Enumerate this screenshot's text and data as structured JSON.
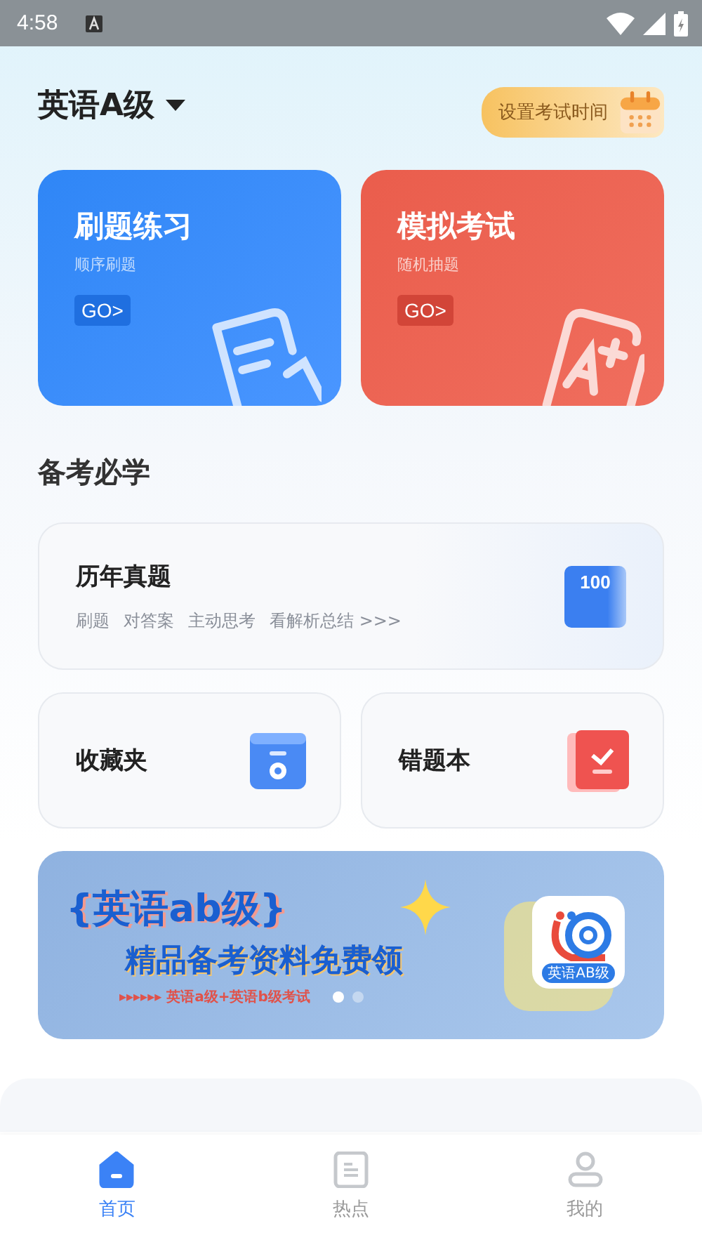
{
  "status_bar": {
    "time": "4:58"
  },
  "header": {
    "title": "英语A级",
    "exam_time_button": "设置考试时间"
  },
  "practice_cards": [
    {
      "kind": "practice",
      "title": "刷题练习",
      "subtitle": "顺序刷题",
      "go": "GO>"
    },
    {
      "kind": "exam",
      "title": "模拟考试",
      "subtitle": "随机抽题",
      "go": "GO>"
    }
  ],
  "section_title": "备考必学",
  "past_papers": {
    "title": "历年真题",
    "tags": [
      "刷题",
      "对答案",
      "主动思考",
      "看解析总结 >>>"
    ],
    "badge": "100"
  },
  "tool_cards": [
    {
      "kind": "favorites",
      "title": "收藏夹"
    },
    {
      "kind": "mistakes",
      "title": "错题本"
    }
  ],
  "banner": {
    "headline": "{英语ab级}",
    "subline": "精品备考资料免费领",
    "note": "▸▸▸▸▸▸  英语a级+英语b级考试",
    "logo_text": "英语AB级",
    "dots": [
      {
        "selected": true
      },
      {
        "selected": false
      }
    ]
  },
  "tabs": [
    {
      "kind": "home",
      "label": "首页",
      "selected": true
    },
    {
      "kind": "hot",
      "label": "热点",
      "selected": false
    },
    {
      "kind": "me",
      "label": "我的",
      "selected": false
    }
  ]
}
